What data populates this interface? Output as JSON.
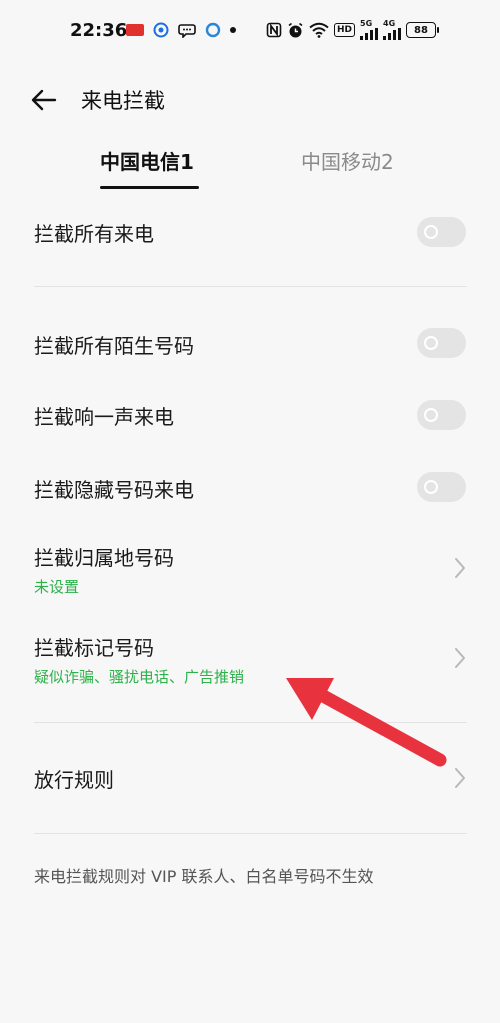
{
  "status_bar": {
    "time": "22:36",
    "battery": "88",
    "hd_label": "HD",
    "signal_1_label": "5G",
    "signal_2_label": "4G"
  },
  "header": {
    "title": "来电拦截"
  },
  "tabs": [
    {
      "label": "中国电信1",
      "active": true
    },
    {
      "label": "中国移动2",
      "active": false
    }
  ],
  "rows": {
    "block_all_calls": {
      "label": "拦截所有来电",
      "enabled": false
    },
    "block_strangers": {
      "label": "拦截所有陌生号码",
      "enabled": false
    },
    "block_one_ring": {
      "label": "拦截响一声来电",
      "enabled": false
    },
    "block_hidden": {
      "label": "拦截隐藏号码来电",
      "enabled": false
    },
    "block_location": {
      "label": "拦截归属地号码",
      "sub": "未设置"
    },
    "block_marked": {
      "label": "拦截标记号码",
      "sub": "疑似诈骗、骚扰电话、广告推销"
    },
    "allow_rules": {
      "label": "放行规则"
    }
  },
  "footer": {
    "note": "来电拦截规则对 VIP 联系人、白名单号码不生效"
  },
  "colors": {
    "accent_green": "#2db24a",
    "annotation_red": "#e8333f",
    "toggle_off": "#e4e4e4"
  }
}
